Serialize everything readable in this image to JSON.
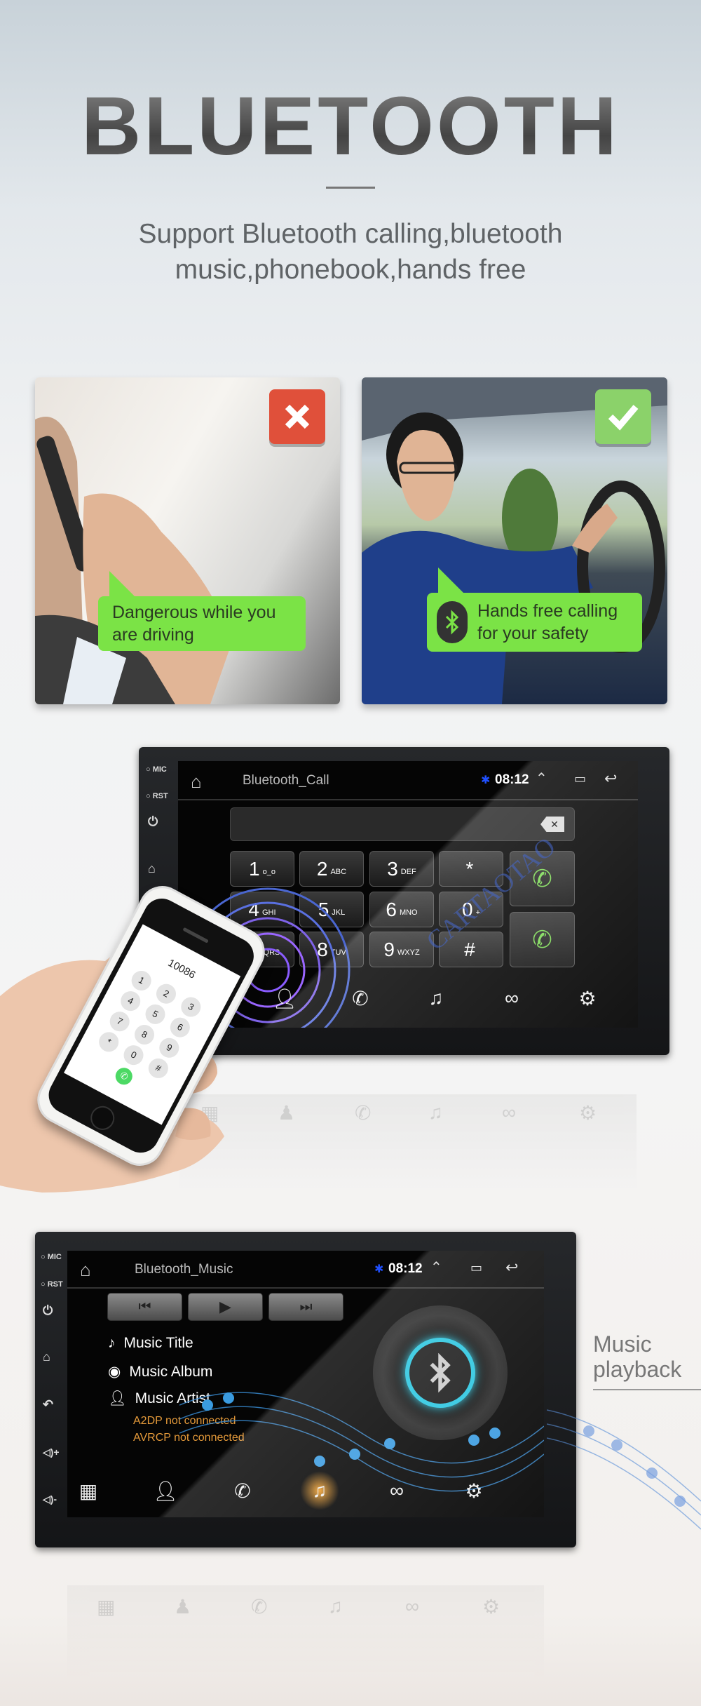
{
  "header": {
    "title": "BLUETOOTH",
    "subtitle_lines": [
      "Support Bluetooth calling,bluetooth",
      "music,phonebook,hands free"
    ]
  },
  "comparison": [
    {
      "verdict": "wrong",
      "badge_color": "#e0503a",
      "bubble_lines": [
        "Dangerous while you",
        "are driving"
      ]
    },
    {
      "verdict": "right",
      "badge_color": "#8bd26a",
      "bubble_lines": [
        "Hands free calling",
        "for your safety"
      ]
    }
  ],
  "bubble_color": "#7be346",
  "call_unit": {
    "side_labels": {
      "mic": "MIC",
      "rst": "RST"
    },
    "app_title": "Bluetooth_Call",
    "time": "08:12",
    "keys": [
      {
        "num": "1",
        "letters": "o_o"
      },
      {
        "num": "2",
        "letters": "ABC"
      },
      {
        "num": "3",
        "letters": "DEF"
      },
      {
        "num": "*",
        "letters": ""
      },
      {
        "num": "4",
        "letters": "GHI"
      },
      {
        "num": "5",
        "letters": "JKL"
      },
      {
        "num": "6",
        "letters": "MNO"
      },
      {
        "num": "0",
        "letters": "+"
      },
      {
        "num": "7",
        "letters": "PQRS"
      },
      {
        "num": "8",
        "letters": "TUV"
      },
      {
        "num": "9",
        "letters": "WXYZ"
      },
      {
        "num": "#",
        "letters": ""
      }
    ],
    "watermark": "CARTAOTAO",
    "nav_icons": [
      "contacts-icon",
      "call-log-icon",
      "music-icon",
      "link-icon",
      "settings-icon"
    ]
  },
  "phone": {
    "dialed_number": "10086",
    "keys": [
      "1",
      "2",
      "3",
      "4",
      "5",
      "6",
      "7",
      "8",
      "9",
      "*",
      "0",
      "#"
    ]
  },
  "music_unit": {
    "side_labels": {
      "mic": "MIC",
      "rst": "RST"
    },
    "app_title": "Bluetooth_Music",
    "time": "08:12",
    "track": {
      "title": "Music Title",
      "album": "Music Album",
      "artist": "Music Artist"
    },
    "status": [
      "A2DP not connected",
      "AVRCP not connected"
    ],
    "active_nav": "music",
    "accent_color": "#f0a030",
    "nav_icons": [
      "dialpad-icon",
      "contacts-icon",
      "call-log-icon",
      "music-icon",
      "link-icon",
      "settings-icon"
    ]
  },
  "music_caption": {
    "lines": [
      "Music",
      "playback"
    ]
  }
}
